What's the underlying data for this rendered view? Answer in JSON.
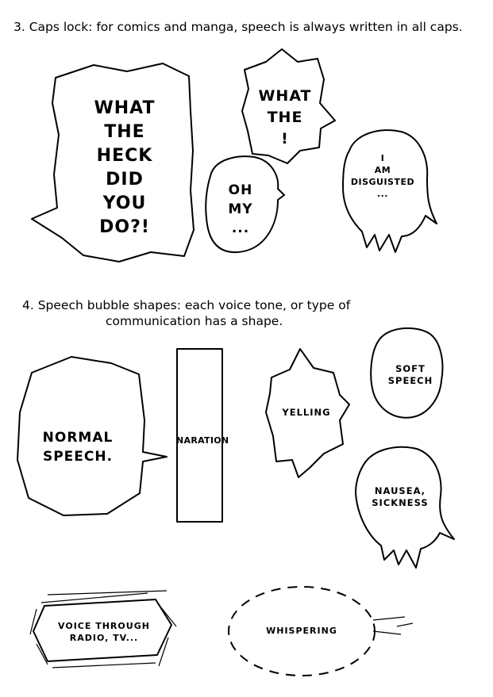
{
  "section3": {
    "heading": "3. Caps lock: for comics and manga, speech is always written in all caps."
  },
  "bubbles_caps": {
    "big": [
      "WHAT",
      "THE",
      "HECK",
      "DID",
      "YOU",
      "DO?!"
    ],
    "what_the": [
      "WHAT",
      "THE",
      "!"
    ],
    "oh_my": [
      "OH",
      "MY",
      "..."
    ],
    "disgusted": [
      "I",
      "AM",
      "DISGUISTED",
      "..."
    ]
  },
  "section4": {
    "heading_line1": "4. Speech bubble shapes: each voice tone, or type of",
    "heading_line2": "communication has a shape."
  },
  "bubbles_shapes": {
    "normal": [
      "NORMAL",
      "SPEECH."
    ],
    "naration": "NARATION",
    "yelling": "YELLING",
    "soft": [
      "SOFT",
      "SPEECH"
    ],
    "nausea": [
      "NAUSEA,",
      "SICKNESS"
    ],
    "radio": [
      "VOICE THROUGH",
      "RADIO, TV..."
    ],
    "whispering": "WHISPERING"
  }
}
